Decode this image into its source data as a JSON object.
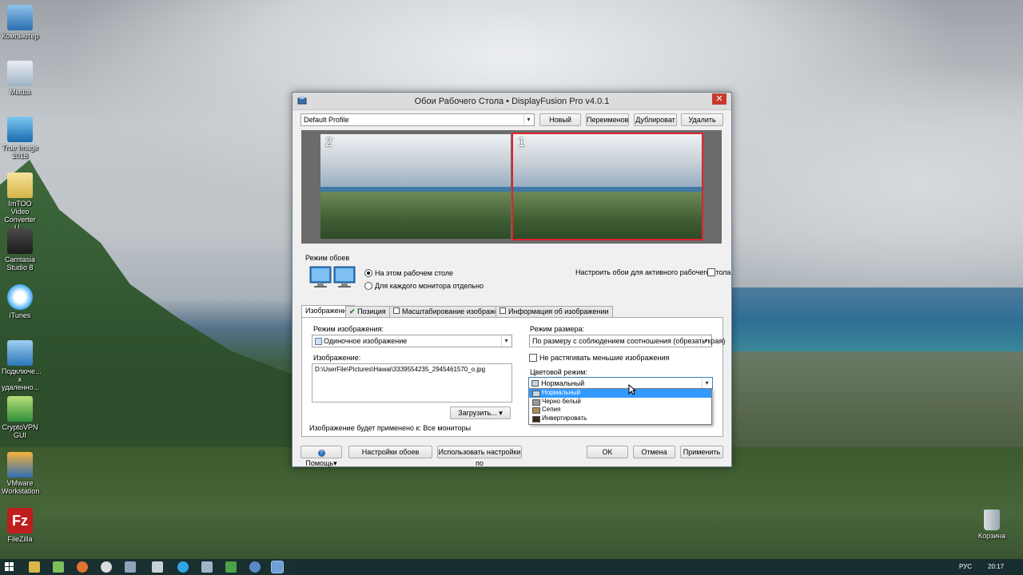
{
  "desktop": {
    "icons": [
      {
        "label": "Компьютер"
      },
      {
        "label": "Мыша"
      },
      {
        "label": "True Image 2018"
      },
      {
        "label": "ImTOO Video Converter U..."
      },
      {
        "label": "Camtasia Studio 8"
      },
      {
        "label": "iTunes"
      },
      {
        "label": "Подключе... к удаленно..."
      },
      {
        "label": "CryptoVPN GUI"
      },
      {
        "label": "VMware Workstation"
      },
      {
        "label": "FileZilla"
      }
    ],
    "recycle_bin": {
      "label": "Корзина"
    }
  },
  "window": {
    "title": "Обои Рабочего Стола • DisplayFusion Pro v4.0.1",
    "close": "✕",
    "profile": {
      "selected": "Default Profile"
    },
    "profile_buttons": {
      "new": "Новый",
      "rename": "Переименов",
      "duplicate": "Дублироват",
      "delete": "Удалить"
    },
    "preview": {
      "monitor2_number": "2",
      "monitor1_number": "1"
    },
    "wallpaper_mode": {
      "label": "Режим обоев",
      "option_this_desktop": "На этом рабочем столе",
      "option_each_monitor": "Для каждого монитора отдельно",
      "active_desktop_label": "Настроить обои для активного рабочего стола"
    },
    "tabs": {
      "image": "Изображение",
      "position": "Позиция",
      "scaling": "Масштабирование изображения",
      "info": "Информация об изображении"
    },
    "image_tab": {
      "image_mode_label": "Режим изображения:",
      "image_mode_value": "Одиночное изображение",
      "image_label": "Изображение:",
      "image_path": "D:\\UserFile\\Pictures\\Hawai\\3339554235_2945461570_o.jpg",
      "load_button": "Загрузить...",
      "applied_to": "Изображение будет применено к: Все мониторы",
      "size_mode_label": "Режим размера:",
      "size_mode_value": "По размеру с соблюдением соотношения (обрезать края)",
      "no_stretch_label": "Не растягивать меньшие изображения",
      "color_mode_label": "Цветовой режим:",
      "color_mode_value": "Нормальный",
      "color_options": [
        {
          "label": "Нормальный",
          "color": "#c8d4e0"
        },
        {
          "label": "Черно белый",
          "color": "#9a9a9a"
        },
        {
          "label": "Сепия",
          "color": "#b08d5a"
        },
        {
          "label": "Инвертировать",
          "color": "#3a2a1a"
        }
      ]
    },
    "footer": {
      "help": "Помощь",
      "wallpaper_settings": "Настройки обоев",
      "use_defaults": "Использовать настройки по",
      "ok": "OK",
      "cancel": "Отмена",
      "apply": "Применить"
    }
  },
  "taskbar": {
    "language": "РУС",
    "time": "20:17"
  }
}
